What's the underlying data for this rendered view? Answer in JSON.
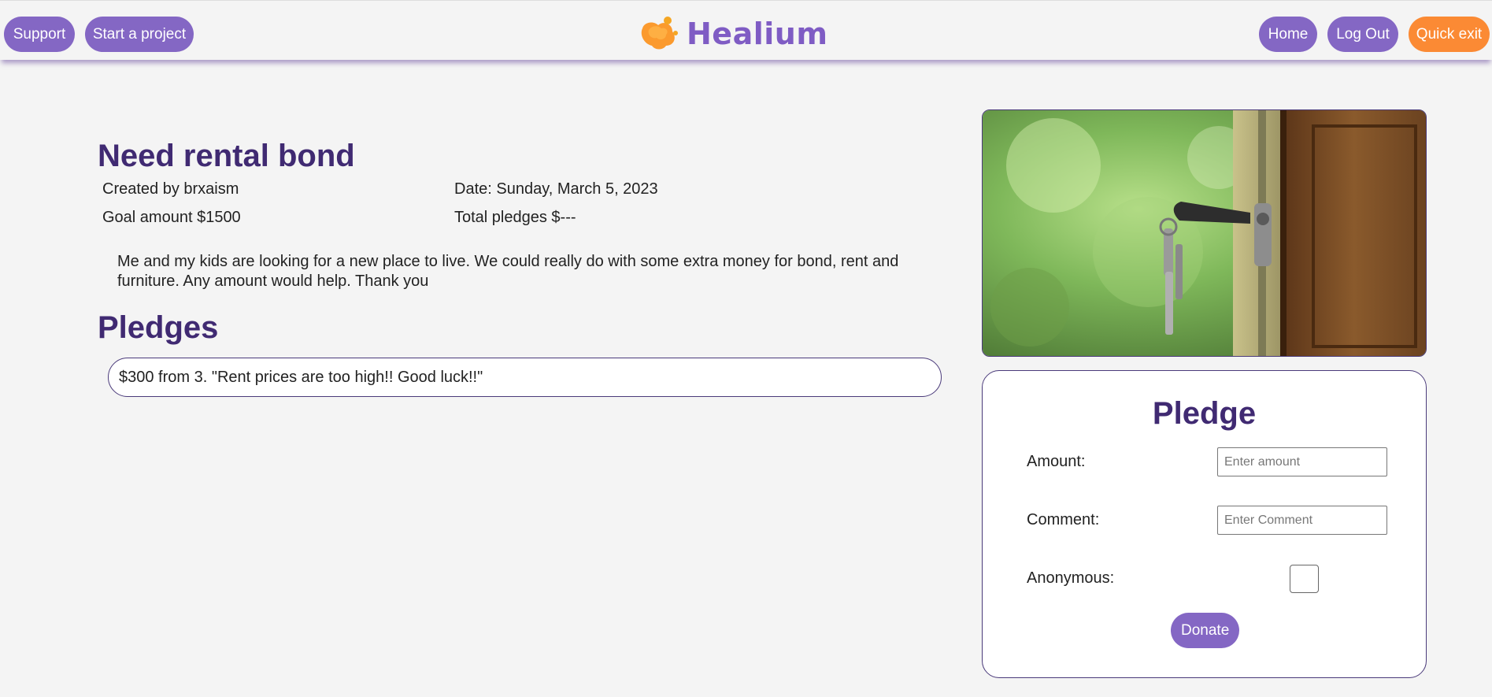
{
  "header": {
    "support_label": "Support",
    "start_project_label": "Start a project",
    "brand": "Healium",
    "home_label": "Home",
    "logout_label": "Log Out",
    "quick_exit_label": "Quick exit"
  },
  "project": {
    "title": "Need rental bond",
    "created_by": "Created by brxaism",
    "date": "Date: Sunday, March 5, 2023",
    "goal": "Goal amount $1500",
    "total_pledges": "Total pledges $---",
    "description": "Me and my kids are looking for a new place to live. We could really do with some extra money for bond, rent and furniture. Any amount would help. Thank you",
    "image_icon": "keys-in-door-photo"
  },
  "pledges": {
    "heading": "Pledges",
    "items": [
      "$300 from 3. \"Rent prices are too high!! Good luck!!\""
    ]
  },
  "pledge_form": {
    "title": "Pledge",
    "amount_label": "Amount:",
    "amount_placeholder": "Enter amount",
    "comment_label": "Comment:",
    "comment_placeholder": "Enter Comment",
    "anonymous_label": "Anonymous:",
    "donate_label": "Donate"
  },
  "colors": {
    "accent_purple": "#8467c4",
    "heading_purple": "#402a72",
    "quick_exit_orange": "#fb8a34",
    "background": "#f4f4f4"
  }
}
